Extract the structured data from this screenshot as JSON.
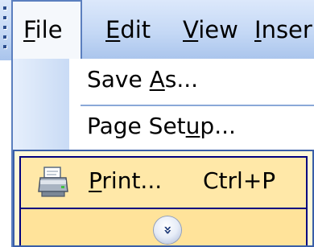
{
  "menubar": {
    "items": [
      {
        "label": "File",
        "mnemonic": "F",
        "rest": "ile"
      },
      {
        "label": "Edit",
        "mnemonic": "E",
        "rest": "dit"
      },
      {
        "label": "View",
        "mnemonic": "V",
        "rest": "iew"
      },
      {
        "label": "Inser",
        "mnemonic": "I",
        "rest": "nser"
      }
    ]
  },
  "file_menu": {
    "items": [
      {
        "label": "Save As...",
        "pre": "Save ",
        "mnemonic": "A",
        "post": "s..."
      },
      {
        "label": "Page Setup...",
        "pre": "Page Set",
        "mnemonic": "u",
        "post": "p..."
      },
      {
        "label": "Print...",
        "pre": "",
        "mnemonic": "P",
        "post": "rint...",
        "shortcut": "Ctrl+P",
        "icon": "printer-icon"
      }
    ],
    "expand_glyph": "»",
    "expand_icon": "expand-chevrons-icon"
  },
  "colors": {
    "menubar_gradient_top": "#dce8fb",
    "menubar_gradient_bottom": "#a9c4ec",
    "highlight_fill": "#ffe8a8",
    "highlight_border": "#000080"
  }
}
